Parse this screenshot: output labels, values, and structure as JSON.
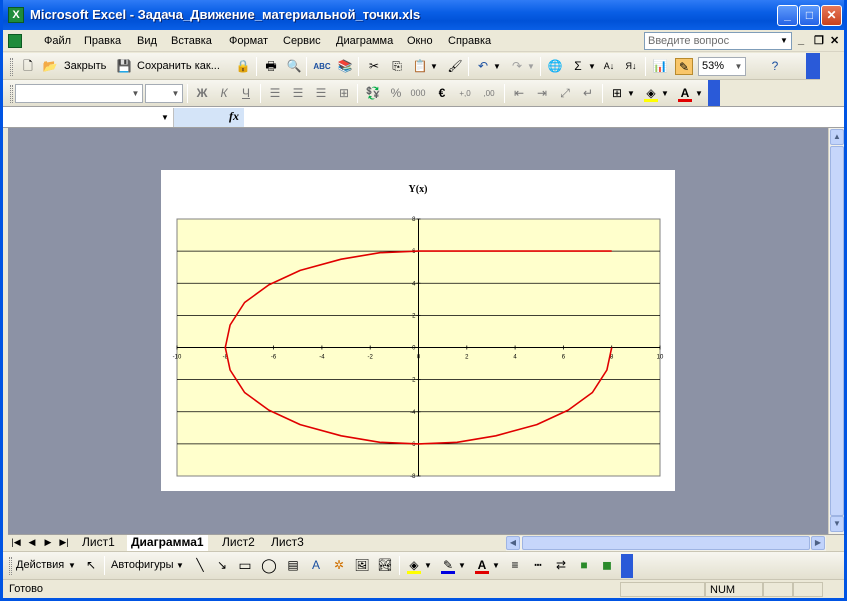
{
  "window": {
    "title": "Microsoft Excel - Задача_Движение_материальной_точки.xls",
    "app_icon": "X"
  },
  "menu": {
    "items": [
      "Файл",
      "Правка",
      "Вид",
      "Вставка",
      "Формат",
      "Сервис",
      "Диаграмма",
      "Окно",
      "Справка"
    ],
    "ask_placeholder": "Введите вопрос"
  },
  "standard_toolbar": {
    "close_label": "Закрыть",
    "save_as_label": "Сохранить как...",
    "zoom": "53%"
  },
  "formatting_toolbar": {
    "bold": "Ж",
    "italic": "К",
    "underline": "Ч",
    "percent": "%",
    "thousands": "000",
    "euro": "€",
    "inc_decimal": "+,0",
    "dec_decimal": ",00"
  },
  "formula_bar": {
    "fx": "fx"
  },
  "sheets": {
    "tabs": [
      "Лист1",
      "Диаграмма1",
      "Лист2",
      "Лист3"
    ],
    "active": "Диаграмма1"
  },
  "draw_toolbar": {
    "actions_label": "Действия",
    "autoshapes_label": "Автофигуры"
  },
  "status": {
    "ready": "Готово",
    "num": "NUM"
  },
  "colors": {
    "plot_bg": "#ffffcc",
    "curve": "#e00000",
    "workspace": "#8c92a5"
  },
  "chart_data": {
    "type": "scatter",
    "title": "Y(x)",
    "xlabel": "",
    "ylabel": "",
    "xlim": [
      -10,
      10
    ],
    "ylim": [
      -8,
      8
    ],
    "x_ticks": [
      -10,
      -8,
      -6,
      -4,
      -2,
      0,
      2,
      4,
      6,
      8,
      10
    ],
    "y_ticks": [
      8,
      6,
      4,
      2,
      0,
      -2,
      -4,
      -6,
      -8
    ],
    "grid": "horizontal",
    "legend": "none",
    "series": [
      {
        "x": [
          8,
          7.8,
          7.2,
          6.2,
          4.9,
          3.2,
          1.6,
          0,
          -1.6,
          -3.2,
          -4.9,
          -6.2,
          -7.2,
          -7.8,
          -8,
          -7.8,
          -7.2,
          -6.2,
          -4.9,
          -3.2,
          -1.6,
          0,
          8
        ],
        "y": [
          0,
          -1.4,
          -2.8,
          -3.9,
          -4.8,
          -5.5,
          -5.9,
          -6,
          -5.9,
          -5.5,
          -4.8,
          -3.9,
          -2.8,
          -1.4,
          0,
          1.4,
          2.8,
          3.9,
          4.8,
          5.5,
          5.9,
          6,
          6
        ]
      }
    ]
  }
}
